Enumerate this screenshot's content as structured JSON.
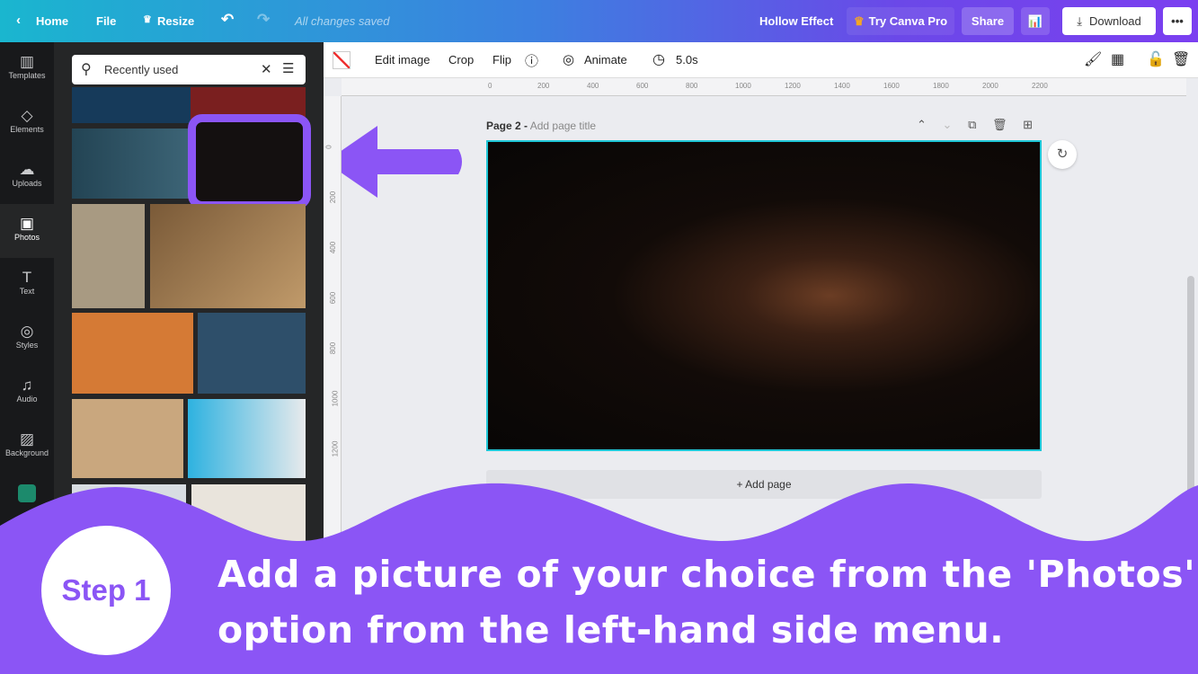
{
  "topbar": {
    "home": "Home",
    "file": "File",
    "resize": "Resize",
    "status": "All changes saved",
    "title": "Hollow Effect",
    "try_pro": "Try Canva Pro",
    "share": "Share",
    "download": "Download",
    "more": "•••"
  },
  "sidebar": {
    "items": [
      {
        "label": "Templates",
        "icon": "▥"
      },
      {
        "label": "Elements",
        "icon": "◇"
      },
      {
        "label": "Uploads",
        "icon": "☁"
      },
      {
        "label": "Photos",
        "icon": "▣"
      },
      {
        "label": "Text",
        "icon": "T"
      },
      {
        "label": "Styles",
        "icon": "◎"
      },
      {
        "label": "Audio",
        "icon": "♫"
      },
      {
        "label": "Background",
        "icon": "▨"
      }
    ]
  },
  "panel": {
    "search_value": "Recently used"
  },
  "toolbar": {
    "edit_image": "Edit image",
    "crop": "Crop",
    "flip": "Flip",
    "animate": "Animate",
    "duration": "5.0s"
  },
  "ruler": {
    "h_ticks": [
      "0",
      "200",
      "400",
      "600",
      "800",
      "1000",
      "1200",
      "1400",
      "1600",
      "1800",
      "2000",
      "2200"
    ],
    "v_ticks": [
      "0",
      "200",
      "400",
      "600",
      "800",
      "1000",
      "1200"
    ]
  },
  "page": {
    "label": "Page 2 -",
    "title_placeholder": "Add page title",
    "add_page": "+ Add page"
  },
  "banner": {
    "step": "Step 1",
    "line1": "Add a picture of your choice from the 'Photos'",
    "line2": "option from the left-hand side menu.",
    "color": "#8b55f5"
  }
}
